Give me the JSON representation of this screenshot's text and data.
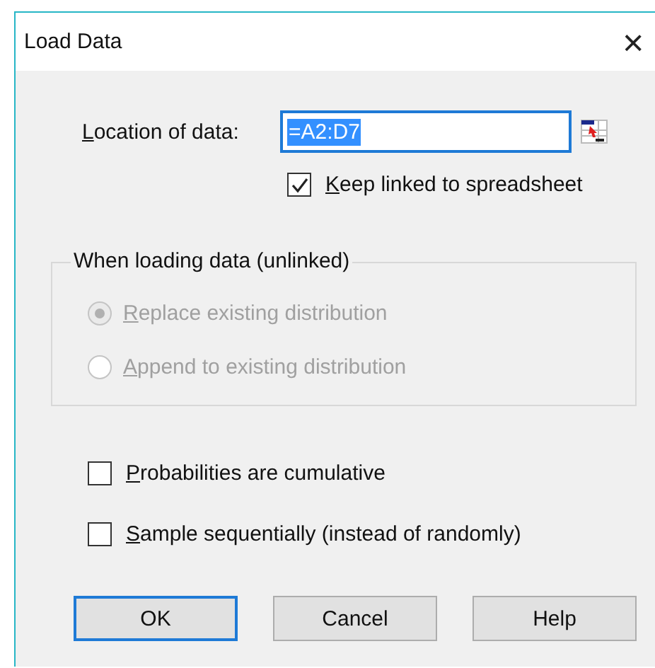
{
  "window": {
    "title": "Load Data",
    "close": "×"
  },
  "location": {
    "label": "Location of data:",
    "value": "=A2:D7",
    "selected": true
  },
  "keep_linked": {
    "label": "Keep linked to spreadsheet",
    "checked": true
  },
  "group": {
    "title": "When loading data (unlinked)",
    "disabled": true,
    "options": [
      {
        "label": "Replace existing distribution",
        "selected": true
      },
      {
        "label": "Append to existing distribution",
        "selected": false
      }
    ]
  },
  "options": [
    {
      "label": "Probabilities are cumulative",
      "checked": false
    },
    {
      "label": "Sample sequentially (instead of randomly)",
      "checked": false
    }
  ],
  "buttons": [
    {
      "label": "OK",
      "default": true
    },
    {
      "label": "Cancel",
      "default": false
    },
    {
      "label": "Help",
      "default": false
    }
  ]
}
